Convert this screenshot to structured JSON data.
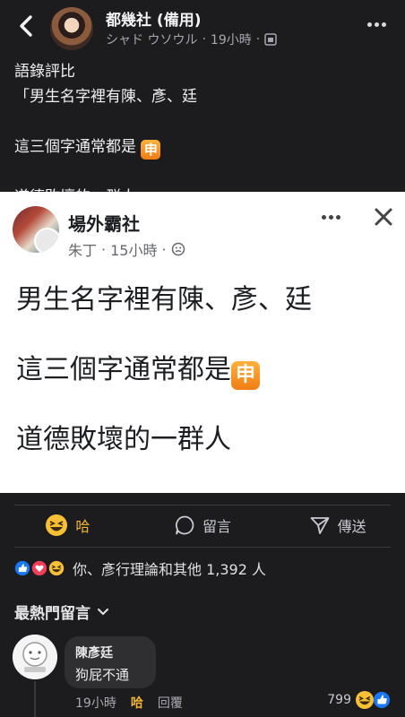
{
  "header": {
    "page_name": "都幾社 (備用)",
    "author": "シャド ウソウル",
    "time": "19小時",
    "separator": "·"
  },
  "caption": {
    "line1": "語錄評比",
    "line2": "「男生名字裡有陳、彥、廷",
    "line3": "這三個字通常都是",
    "line4": "道德敗壞的一群人」"
  },
  "embedded_post": {
    "page_name": "場外霸社",
    "author": "朱丁",
    "time": "15小時",
    "separator": "·",
    "line1": "男生名字裡有陳、彥、廷",
    "line2": "這三個字通常都是",
    "line3": "道德敗壞的一群人",
    "emoji_char": "申"
  },
  "actions": {
    "react_label": "哈",
    "comment_label": "留言",
    "share_label": "傳送"
  },
  "reactions": {
    "summary": "你、彥行理論和其他 1,392 人"
  },
  "comments": {
    "sort_label": "最熱門留言",
    "items": [
      {
        "name": "陳彥廷",
        "text": "狗屁不通",
        "time": "19小時",
        "react_action": "哈",
        "reply_action": "回覆",
        "reaction_count": "799"
      }
    ]
  },
  "colors": {
    "background": "#1c1c1e",
    "haha_yellow": "#f3b53a",
    "like_blue": "#1877f2",
    "love_red": "#f33e58"
  }
}
